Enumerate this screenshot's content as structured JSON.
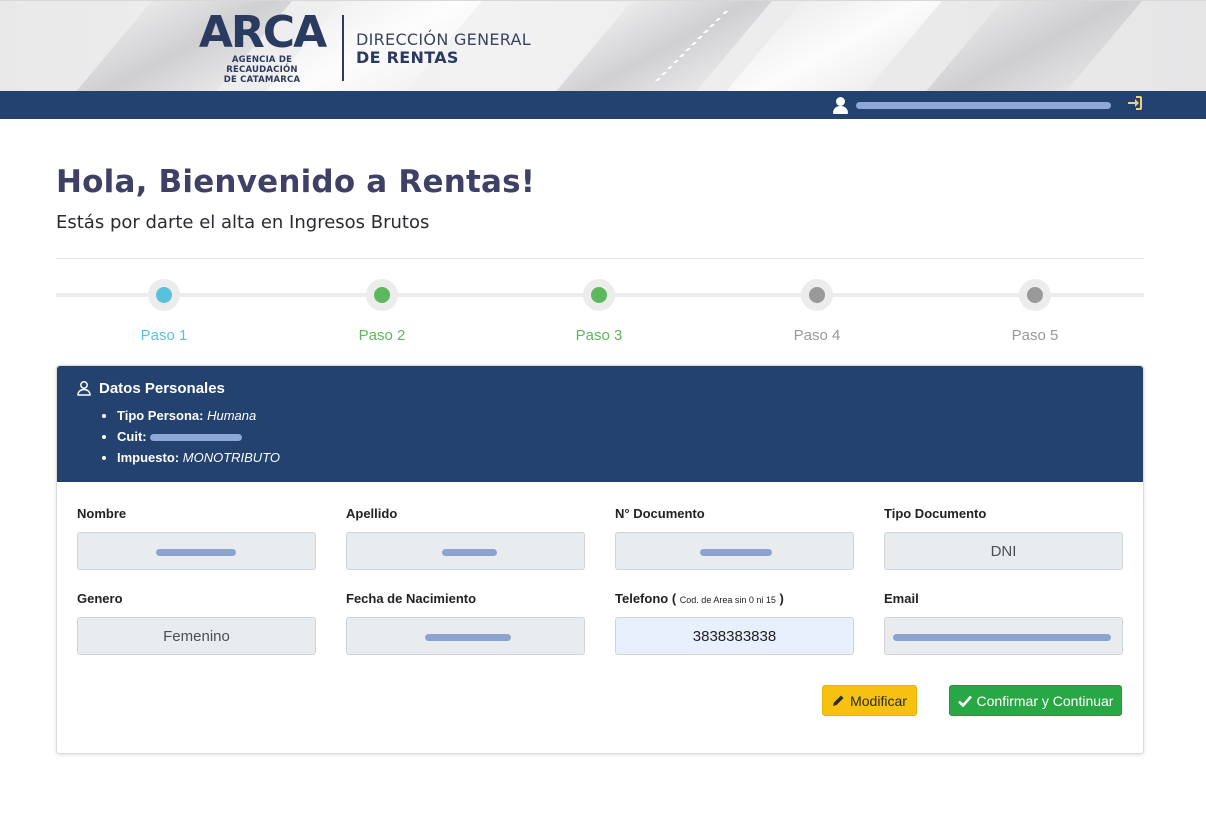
{
  "header": {
    "logo_word": "ARCA",
    "logo_sub_1": "AGENCIA DE RECAUDACIÓN",
    "logo_sub_2": "DE CATAMARCA",
    "dept_line_1": "DIRECCIÓN GENERAL",
    "dept_line_2": "DE RENTAS"
  },
  "navbar": {
    "user_icon": "user-icon",
    "logout_icon": "sign-in-icon"
  },
  "page": {
    "title": "Hola, Bienvenido a Rentas!",
    "subtitle": "Estás por darte el alta en Ingresos Brutos"
  },
  "steps": [
    {
      "label": "Paso 1",
      "color": "#5bc0de"
    },
    {
      "label": "Paso 2",
      "color": "#5cb85c"
    },
    {
      "label": "Paso 3",
      "color": "#5cb85c"
    },
    {
      "label": "Paso 4",
      "color": "#999999"
    },
    {
      "label": "Paso 5",
      "color": "#999999"
    }
  ],
  "card": {
    "title": "Datos Personales",
    "tipo_persona_label": "Tipo Persona:",
    "tipo_persona_value": "Humana",
    "cuit_label": "Cuit:",
    "impuesto_label": "Impuesto:",
    "impuesto_value": "MONOTRIBUTO"
  },
  "fields": {
    "nombre": {
      "label": "Nombre"
    },
    "apellido": {
      "label": "Apellido"
    },
    "documento": {
      "label": "N° Documento"
    },
    "tipo_documento": {
      "label": "Tipo Documento",
      "value": "DNI"
    },
    "genero": {
      "label": "Genero",
      "value": "Femenino"
    },
    "fecha_nacimiento": {
      "label": "Fecha de Nacimiento"
    },
    "telefono": {
      "label": "Telefono",
      "hint_open": "(",
      "hint": "Cod. de Area sin 0 ni 15",
      "hint_close": ")",
      "value": "3838383838"
    },
    "email": {
      "label": "Email"
    }
  },
  "buttons": {
    "modificar": "Modificar",
    "confirmar": "Confirmar y Continuar"
  },
  "colors": {
    "primary_dark": "#23426f",
    "title": "#3f4066",
    "warning": "#f7c10f",
    "success": "#28a745"
  }
}
